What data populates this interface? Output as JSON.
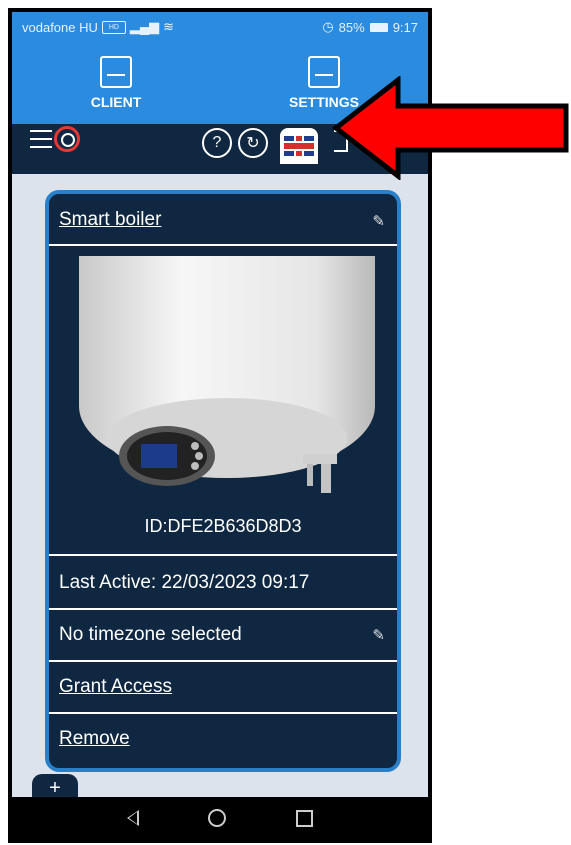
{
  "status_bar": {
    "carrier": "vodafone HU",
    "battery": "85%",
    "time": "9:17"
  },
  "top_nav": {
    "tabs": [
      {
        "label": "CLIENT",
        "icon": "client-icon"
      },
      {
        "label": "SETTINGS",
        "icon": "settings-icon"
      }
    ]
  },
  "toolbar": {
    "help_label": "?",
    "refresh_label": "↻"
  },
  "device_card": {
    "name": "Smart boiler",
    "device_id": "ID:DFE2B636D8D3",
    "last_active": "Last Active: 22/03/2023 09:17",
    "timezone": "No timezone selected",
    "grant_access": "Grant Access",
    "remove": "Remove"
  },
  "fab_label": "+",
  "colors": {
    "header_blue": "#2a8bdf",
    "card_navy": "#0f2740",
    "card_border": "#2a7fc9",
    "arrow_red": "#ff0000"
  }
}
